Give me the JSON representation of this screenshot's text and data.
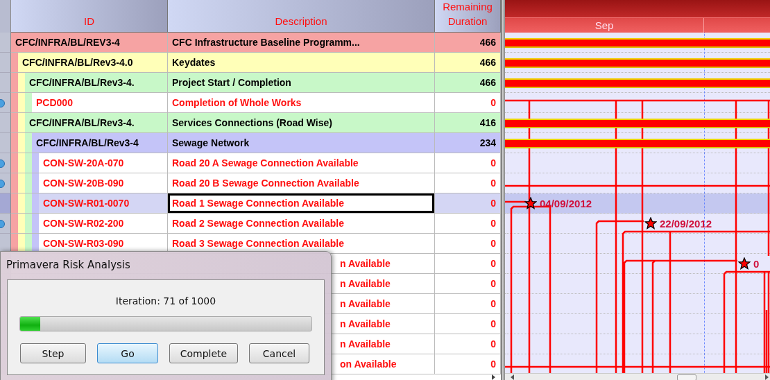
{
  "table": {
    "columns": [
      {
        "label": "ID"
      },
      {
        "label": "Description"
      },
      {
        "label": "Remaining Duration"
      }
    ],
    "rows": [
      {
        "kind": "wbs",
        "id": "CFC/INFRA/BL/REV3-4",
        "description": "CFC Infrastructure Baseline Programm...",
        "remaining_duration": "466",
        "selected": false,
        "marker": false,
        "children": [
          {
            "kind": "wbs",
            "id": "CFC/INFRA/BL/Rev3-4.0",
            "description": "Keydates",
            "remaining_duration": "466",
            "selected": false,
            "marker": false,
            "children": [
              {
                "kind": "wbs",
                "id": "CFC/INFRA/BL/Rev3-4.",
                "description": "Project Start / Completion",
                "remaining_duration": "466",
                "selected": false,
                "marker": false,
                "children": [
                  {
                    "kind": "activity",
                    "id": "PCD000",
                    "description": "Completion of Whole Works",
                    "remaining_duration": "0",
                    "selected": false,
                    "marker": true
                  }
                ]
              },
              {
                "kind": "wbs",
                "id": "CFC/INFRA/BL/Rev3-4.",
                "description": "Services Connections (Road Wise)",
                "remaining_duration": "416",
                "selected": false,
                "marker": false,
                "children": [
                  {
                    "kind": "wbs",
                    "id": "CFC/INFRA/BL/Rev3-4",
                    "description": "Sewage Network",
                    "remaining_duration": "234",
                    "selected": false,
                    "marker": false,
                    "children": [
                      {
                        "kind": "activity",
                        "id": "CON-SW-20A-070",
                        "description": "Road 20 A Sewage Connection Available",
                        "remaining_duration": "0",
                        "selected": false,
                        "marker": true
                      },
                      {
                        "kind": "activity",
                        "id": "CON-SW-20B-090",
                        "description": "Road 20 B Sewage Connection Available",
                        "remaining_duration": "0",
                        "selected": false,
                        "marker": true
                      },
                      {
                        "kind": "activity",
                        "id": "CON-SW-R01-0070",
                        "description": "Road 1 Sewage Connection Available",
                        "remaining_duration": "0",
                        "selected": true,
                        "marker": false,
                        "milestone": "04/09/2012"
                      },
                      {
                        "kind": "activity",
                        "id": "CON-SW-R02-200",
                        "description": "Road 2 Sewage Connection Available",
                        "remaining_duration": "0",
                        "selected": false,
                        "marker": true,
                        "milestone": "22/09/2012"
                      },
                      {
                        "kind": "activity",
                        "id": "CON-SW-R03-090",
                        "description": "Road 3 Sewage Connection Available",
                        "remaining_duration": "0",
                        "selected": false,
                        "marker": false
                      },
                      {
                        "kind": "activity",
                        "description": "n Available",
                        "remaining_duration": "0",
                        "selected": false,
                        "marker": false,
                        "milestone": "0"
                      },
                      {
                        "kind": "activity",
                        "description": "n Available",
                        "remaining_duration": "0",
                        "selected": false,
                        "marker": false
                      },
                      {
                        "kind": "activity",
                        "description": "n Available",
                        "remaining_duration": "0",
                        "selected": false,
                        "marker": false
                      },
                      {
                        "kind": "activity",
                        "description": "n Available",
                        "remaining_duration": "0",
                        "selected": false,
                        "marker": false
                      },
                      {
                        "kind": "activity",
                        "description": "n Available",
                        "remaining_duration": "0",
                        "selected": false,
                        "marker": false
                      },
                      {
                        "kind": "activity",
                        "description": "on Available",
                        "remaining_duration": "0",
                        "selected": false,
                        "marker": false
                      }
                    ]
                  }
                ]
              }
            ]
          }
        ]
      }
    ]
  },
  "gantt": {
    "months": [
      {
        "label": "Sep"
      }
    ]
  },
  "dialog": {
    "title": "Primavera Risk Analysis",
    "status": "Iteration: 71 of 1000",
    "progress": {
      "level": 0.07
    },
    "buttons": [
      {
        "label": "Step",
        "default": false
      },
      {
        "label": "Go",
        "default": true
      },
      {
        "label": "Complete",
        "default": false
      },
      {
        "label": "Cancel",
        "default": false
      }
    ]
  }
}
